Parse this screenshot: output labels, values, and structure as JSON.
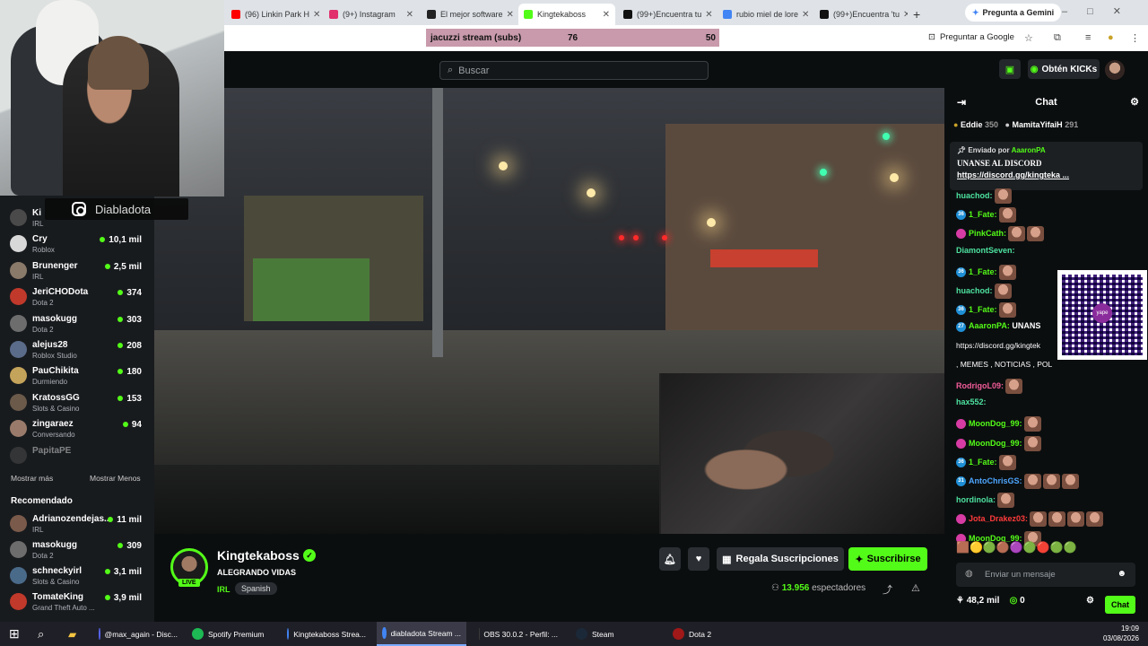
{
  "browser": {
    "tabs": [
      {
        "label": "(96) Linkin Park H",
        "fav_color": "#ff0000"
      },
      {
        "label": "(9+) Instagram",
        "fav_color": "#e1306c"
      },
      {
        "label": "El mejor software",
        "fav_color": "#222222"
      },
      {
        "label": "Kingtekaboss",
        "fav_color": "#53fc18"
      },
      {
        "label": "(99+)Encuentra tu",
        "fav_color": "#111111"
      },
      {
        "label": "rubio miel de lore",
        "fav_color": "#4285f4"
      },
      {
        "label": "(99+)Encuentra 'tu",
        "fav_color": "#111111"
      }
    ],
    "new_tab": "+",
    "gemini_label": "Pregunta a Gemini",
    "yt_bar": {
      "label": "jacuzzi stream (subs)",
      "value1": "76",
      "value2": "50"
    },
    "ask_google": "Preguntar a Google"
  },
  "kick": {
    "search_placeholder": "Buscar",
    "get_kicks": "Obtén KICKs"
  },
  "overlay": {
    "instagram_handle": "Diabladota"
  },
  "sidebar": {
    "following": [
      {
        "name": "Ki",
        "category": "IRL",
        "count": "",
        "color": "#4a4a4a"
      },
      {
        "name": "Cry",
        "category": "Roblox",
        "count": "10,1 mil",
        "color": "#d8d8d8"
      },
      {
        "name": "Brunenger",
        "category": "IRL",
        "count": "2,5 mil",
        "color": "#8a7a6a"
      },
      {
        "name": "JeriCHODota",
        "category": "Dota 2",
        "count": "374",
        "color": "#c0392b"
      },
      {
        "name": "masokugg",
        "category": "Dota 2",
        "count": "303",
        "color": "#6d6d6d"
      },
      {
        "name": "alejus28",
        "category": "Roblox Studio",
        "count": "208",
        "color": "#5b6b8a"
      },
      {
        "name": "PauChikita",
        "category": "Durmiendo",
        "count": "180",
        "color": "#c4a35a"
      },
      {
        "name": "KratossGG",
        "category": "Slots & Casino",
        "count": "153",
        "color": "#6b5a4a"
      },
      {
        "name": "zingaraez",
        "category": "Conversando",
        "count": "94",
        "color": "#9a7b6b"
      },
      {
        "name": "PapitaPE",
        "category": "",
        "count": "",
        "color": "#555555"
      }
    ],
    "show_more": "Mostrar más",
    "show_less": "Mostrar Menos",
    "recommended_title": "Recomendado",
    "recommended": [
      {
        "name": "Adrianozendejas...",
        "category": "IRL",
        "count": "11 mil",
        "color": "#7a5a4a"
      },
      {
        "name": "masokugg",
        "category": "Dota 2",
        "count": "309",
        "color": "#6d6d6d"
      },
      {
        "name": "schneckyirl",
        "category": "Slots & Casino",
        "count": "3,1 mil",
        "color": "#4a6a8a"
      },
      {
        "name": "TomateKing",
        "category": "Grand Theft Auto ...",
        "count": "3,9 mil",
        "color": "#c0392b"
      }
    ]
  },
  "channel": {
    "name": "Kingtekaboss",
    "live": "LIVE",
    "title": "ALEGRANDO VIDAS",
    "category": "IRL",
    "language": "Spanish",
    "gift_label": "Regala Suscripciones",
    "subscribe_label": "Suscribirse",
    "viewers": "13.956",
    "viewers_suffix": "espectadores"
  },
  "chat": {
    "title": "Chat",
    "gifters": [
      {
        "name": "Eddie",
        "count": "350"
      },
      {
        "name": "MamitaYifaiH",
        "count": "291"
      }
    ],
    "pinned_by_prefix": "Enviado por",
    "pinned_by": "AaaronPA",
    "pinned_text": "UNANSE AL DISCORD",
    "pinned_link": "https://discord.gg/kingteka",
    "pinned_more": "...",
    "messages": [
      {
        "user": "huachod:",
        "color": "#4de2a0",
        "badge": "",
        "badge_color": "",
        "emotes": 1
      },
      {
        "user": "1_Fate:",
        "color": "#53fc18",
        "badge": "36",
        "badge_color": "#1f8fd6",
        "emotes": 1
      },
      {
        "user": "PinkCath:",
        "color": "#53fc18",
        "badge": "",
        "badge_color": "#d63ca3",
        "emotes": 2
      },
      {
        "user": "DiamontSeven:",
        "color": "#4de2a0",
        "badge": "",
        "badge_color": "",
        "emotes": 0
      },
      {
        "user": "1_Fate:",
        "color": "#53fc18",
        "badge": "36",
        "badge_color": "#1f8fd6",
        "emotes": 1
      },
      {
        "user": "huachod:",
        "color": "#4de2a0",
        "badge": "",
        "badge_color": "",
        "emotes": 1
      },
      {
        "user": "1_Fate:",
        "color": "#53fc18",
        "badge": "36",
        "badge_color": "#1f8fd6",
        "emotes": 1
      },
      {
        "user": "AaaronPA:",
        "color": "#53fc18",
        "badge": "27",
        "badge_color": "#1f8fd6",
        "emotes": 0,
        "text": "UNANS"
      },
      {
        "user": "",
        "color": "#ffffff",
        "badge": "",
        "badge_color": "",
        "emotes": 0,
        "text": "https://discord.gg/kingtek"
      },
      {
        "user": "",
        "color": "#ffffff",
        "badge": "",
        "badge_color": "",
        "emotes": 0,
        "text": ", MEMES , NOTICIAS , POL"
      },
      {
        "user": "RodrigoL09:",
        "color": "#f25c9a",
        "badge": "",
        "badge_color": "",
        "emotes": 1
      },
      {
        "user": "hax552:",
        "color": "#4de2a0",
        "badge": "",
        "badge_color": "",
        "emotes": 0
      },
      {
        "user": "MoonDog_99:",
        "color": "#53fc18",
        "badge": "",
        "badge_color": "#d63ca3",
        "emotes": 1
      },
      {
        "user": "MoonDog_99:",
        "color": "#53fc18",
        "badge": "",
        "badge_color": "#d63ca3",
        "emotes": 1
      },
      {
        "user": "1_Fate:",
        "color": "#53fc18",
        "badge": "36",
        "badge_color": "#1f8fd6",
        "emotes": 1
      },
      {
        "user": "AntoChrisGS:",
        "color": "#4da6ff",
        "badge": "31",
        "badge_color": "#1f8fd6",
        "emotes": 3
      },
      {
        "user": "hordinola:",
        "color": "#4de2a0",
        "badge": "",
        "badge_color": "",
        "emotes": 1
      },
      {
        "user": "Jota_Drakez03:",
        "color": "#ff3b3b",
        "badge": "",
        "badge_color": "#d63ca3",
        "emotes": 4
      },
      {
        "user": "MoonDog_99:",
        "color": "#53fc18",
        "badge": "",
        "badge_color": "#d63ca3",
        "emotes": 1
      }
    ],
    "qr_label": "yape",
    "input_placeholder": "Enviar un mensaje",
    "kicks_count": "48,2 mil",
    "points": "0",
    "chat_button": "Chat"
  },
  "taskbar": {
    "items": [
      {
        "label": "@max_again - Disc...",
        "color": "#5865f2"
      },
      {
        "label": "Spotify Premium",
        "color": "#1db954"
      },
      {
        "label": "Kingtekaboss Strea...",
        "color": "#4285f4"
      },
      {
        "label": "diabladota Stream ...",
        "color": "#4285f4"
      },
      {
        "label": "OBS 30.0.2 - Perfil: ...",
        "color": "#3a3a3a"
      },
      {
        "label": "Steam",
        "color": "#1b2838"
      },
      {
        "label": "Dota 2",
        "color": "#a01818"
      }
    ],
    "time": "19:09",
    "date": "03/08/2026"
  }
}
